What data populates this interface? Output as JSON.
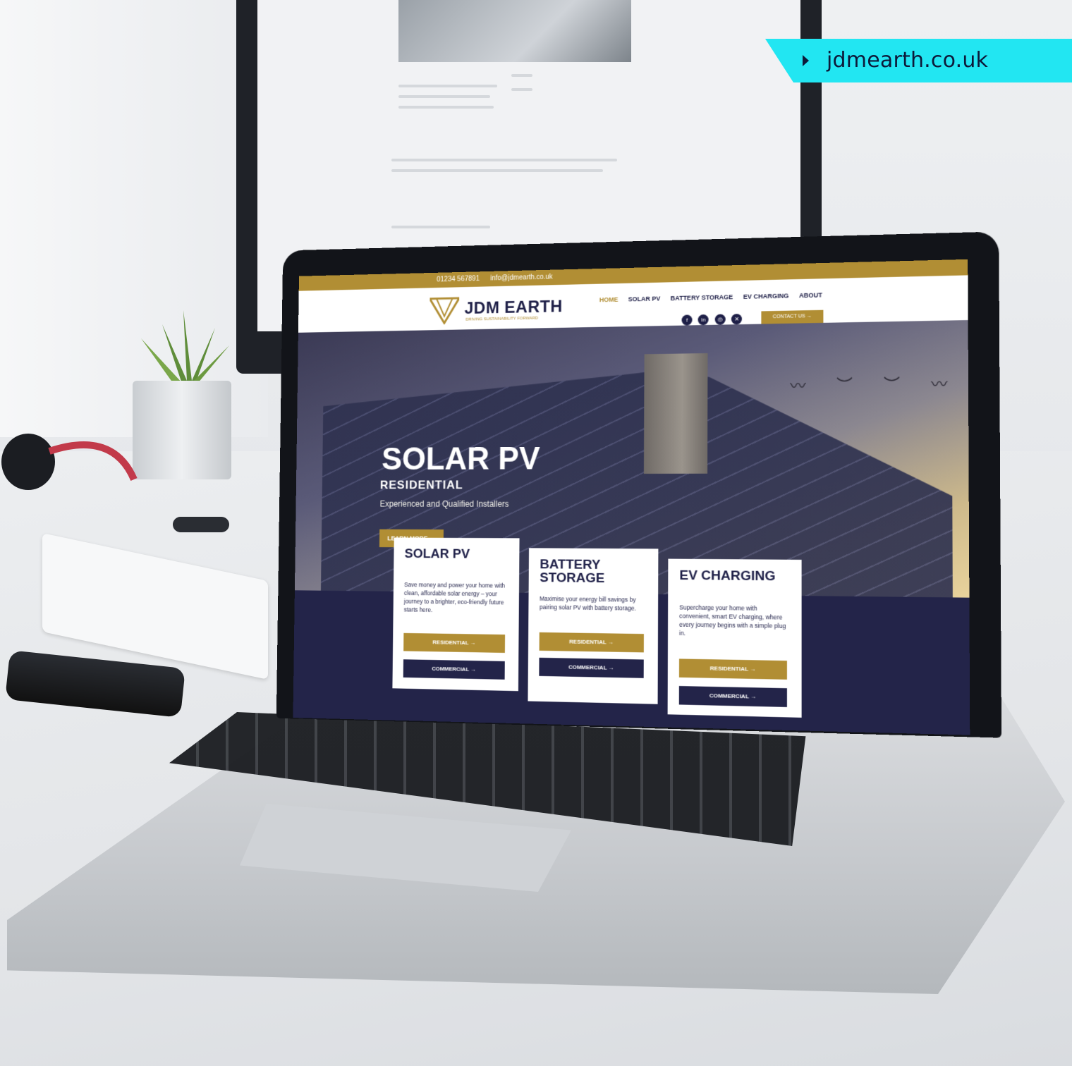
{
  "url_tag": {
    "text": "jdmearth.co.uk"
  },
  "website": {
    "topbar": {
      "phone": "01234 567891",
      "email": "info@jdmearth.co.uk"
    },
    "logo": {
      "name": "JDM EARTH",
      "tagline": "DRIVING SUSTAINABILITY FORWARD"
    },
    "nav": {
      "items": [
        "HOME",
        "SOLAR PV",
        "BATTERY STORAGE",
        "EV CHARGING",
        "ABOUT"
      ],
      "active": "HOME"
    },
    "contact_button": "CONTACT US →",
    "social_icons": [
      "facebook-icon",
      "linkedin-icon",
      "instagram-icon",
      "x-icon"
    ],
    "hero": {
      "title": "SOLAR PV",
      "subtitle": "RESIDENTIAL",
      "description": "Experienced and Qualified Installers",
      "button": "LEARN MORE →"
    },
    "cards": [
      {
        "title": "SOLAR PV",
        "text": "Save money and power your home with clean, affordable solar energy – your journey to a brighter, eco-friendly future starts here.",
        "btn1": "RESIDENTIAL →",
        "btn2": "COMMERCIAL →"
      },
      {
        "title": "BATTERY STORAGE",
        "text": "Maximise your energy bill savings by pairing solar PV with battery storage.",
        "btn1": "RESIDENTIAL →",
        "btn2": "COMMERCIAL →"
      },
      {
        "title": "EV CHARGING",
        "text": "Supercharge your home with convenient, smart EV charging, where every journey begins with a simple plug in.",
        "btn1": "RESIDENTIAL →",
        "btn2": "COMMERCIAL →"
      }
    ],
    "colors": {
      "gold": "#b18e34",
      "navy": "#232449",
      "tag": "#22e6f2"
    }
  }
}
